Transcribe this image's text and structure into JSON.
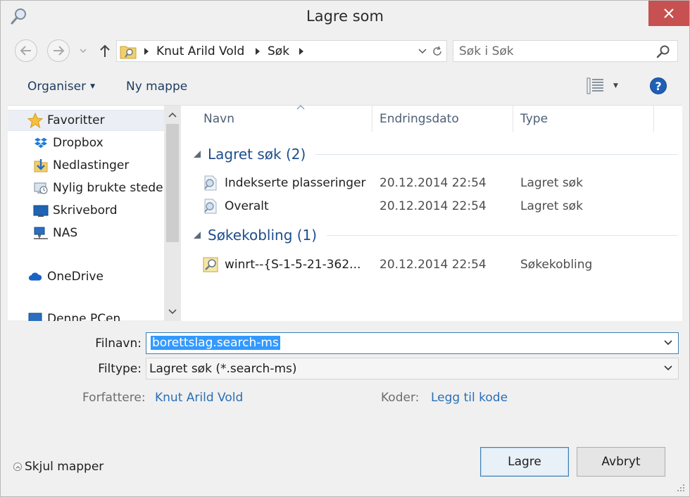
{
  "window": {
    "title": "Lagre som",
    "colors": {
      "close": "#c75050",
      "accent": "#3399ff",
      "link": "#2a6fb5",
      "group": "#1e4e8c"
    }
  },
  "address": {
    "segments": [
      "Knut Arild Vold",
      "Søk"
    ],
    "search_placeholder": "Søk i Søk"
  },
  "toolbar": {
    "organise_label": "Organiser",
    "new_folder_label": "Ny mappe",
    "help_label": "?"
  },
  "nav_pane": {
    "items": [
      {
        "label": "Favoritter",
        "icon": "star-icon"
      },
      {
        "label": "Dropbox",
        "icon": "dropbox-icon"
      },
      {
        "label": "Nedlastinger",
        "icon": "downloads-folder-icon"
      },
      {
        "label": "Nylig brukte steder",
        "icon": "recent-places-icon"
      },
      {
        "label": "Skrivebord",
        "icon": "desktop-icon"
      },
      {
        "label": "NAS",
        "icon": "network-icon"
      },
      {
        "label": "OneDrive",
        "icon": "cloud-icon"
      },
      {
        "label": "Denne PCen",
        "icon": "computer-icon"
      }
    ]
  },
  "file_list": {
    "columns": {
      "name": "Navn",
      "date": "Endringsdato",
      "type": "Type"
    },
    "groups": [
      {
        "title": "Lagret søk (2)",
        "rows": [
          {
            "name": "Indekserte plasseringer",
            "date": "20.12.2014 22:54",
            "type": "Lagret søk",
            "icon": "saved-search-icon"
          },
          {
            "name": "Overalt",
            "date": "20.12.2014 22:54",
            "type": "Lagret søk",
            "icon": "saved-search-icon"
          }
        ]
      },
      {
        "title": "Søkekobling (1)",
        "rows": [
          {
            "name": "winrt--{S-1-5-21-362...",
            "date": "20.12.2014 22:54",
            "type": "Søkekobling",
            "icon": "search-connector-icon"
          }
        ]
      }
    ]
  },
  "form": {
    "filename_label": "Filnavn:",
    "filename_value": "borettslag.search-ms",
    "filetype_label": "Filtype:",
    "filetype_value": "Lagret søk (*.search-ms)",
    "author_label": "Forfattere:",
    "author_value": "Knut Arild Vold",
    "tags_label": "Koder:",
    "tags_value": "Legg til kode"
  },
  "footer": {
    "hide_folders_label": "Skjul mapper",
    "save_label": "Lagre",
    "cancel_label": "Avbryt"
  }
}
